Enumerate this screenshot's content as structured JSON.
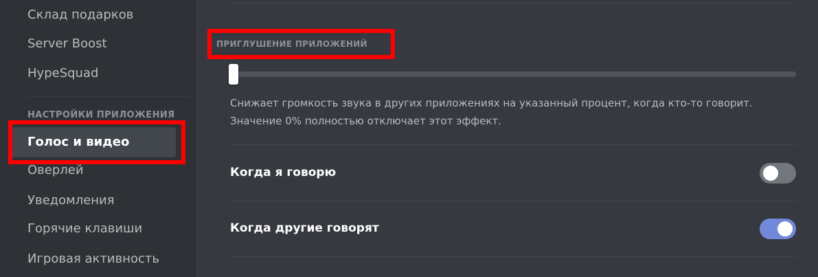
{
  "sidebar": {
    "items_top": [
      {
        "label": "Склад подарков"
      },
      {
        "label": "Server Boost"
      },
      {
        "label": "HypeSquad"
      }
    ],
    "section_header": "НАСТРОЙКИ ПРИЛОЖЕНИЯ",
    "items_app": [
      {
        "label": "Голос и видео",
        "selected": true
      },
      {
        "label": "Оверлей"
      },
      {
        "label": "Уведомления"
      },
      {
        "label": "Горячие клавиши"
      },
      {
        "label": "Игровая активность"
      }
    ]
  },
  "main": {
    "attenuation": {
      "title": "ПРИГЛУШЕНИЕ ПРИЛОЖЕНИЙ",
      "value_percent": 0,
      "description": "Снижает громкость звука в других приложениях на указанный процент, когда кто-то говорит. Значение 0% полностью отключает этот эффект."
    },
    "toggles": [
      {
        "label": "Когда я говорю",
        "enabled": false
      },
      {
        "label": "Когда другие говорят",
        "enabled": true
      }
    ]
  },
  "colors": {
    "sidebar_bg": "#2f3136",
    "main_bg": "#36393f",
    "accent": "#7289da",
    "highlight": "#ff0000",
    "toggle_off": "#72767d"
  }
}
